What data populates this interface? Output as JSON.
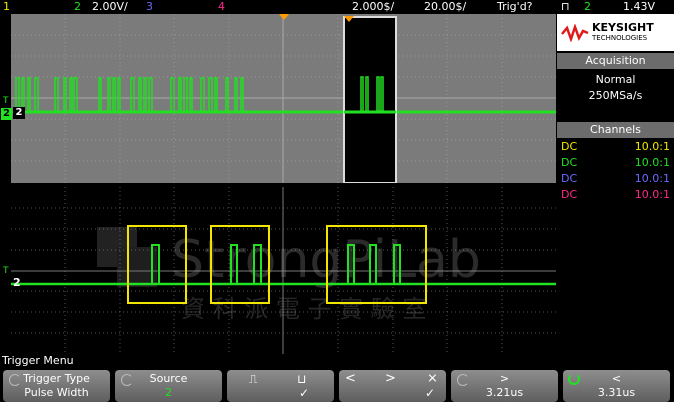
{
  "status": {
    "ch1": "1",
    "ch2": "2",
    "ch2_scale": "2.00V/",
    "ch3": "3",
    "ch4": "4",
    "timebase": "2.000$/",
    "zoom_time": "20.00$/",
    "trig_state": "Trig'd?",
    "trig_channel": "2",
    "trig_level": "1.43V"
  },
  "brand": {
    "name": "KEYSIGHT",
    "sub": "TECHNOLOGIES"
  },
  "acquisition": {
    "header": "Acquisition",
    "mode": "Normal",
    "rate": "250MSa/s"
  },
  "channels": {
    "header": "Channels",
    "rows": [
      {
        "coupling": "DC",
        "probe": "10.0:1",
        "color": "#f2e600"
      },
      {
        "coupling": "DC",
        "probe": "10.0:1",
        "color": "#22e022"
      },
      {
        "coupling": "DC",
        "probe": "10.0:1",
        "color": "#6a6aff"
      },
      {
        "coupling": "DC",
        "probe": "10.0:1",
        "color": "#ff2a8a"
      }
    ]
  },
  "watermark": {
    "text": "StrongPiLab",
    "sub": "資 科 派 電 子 實 驗 室"
  },
  "markers": {
    "ch2": "2",
    "trigger": "T"
  },
  "trigger_menu": {
    "title": "Trigger Menu"
  },
  "softkeys": {
    "trigger_type": {
      "label": "Trigger Type",
      "value": "Pulse Width"
    },
    "source": {
      "label": "Source",
      "value": "2"
    },
    "polarity": {
      "pos": "⎍",
      "neg": "⊔",
      "check": "✓"
    },
    "qualifier": {
      "lt": "<",
      "gt": ">",
      "range": "⨯",
      "check": "✓"
    },
    "gt_time": {
      "symbol": ">",
      "value": "3.21us"
    },
    "lt_time": {
      "symbol": "<",
      "value": "3.31us"
    }
  },
  "colors": {
    "ch1": "#f2e600",
    "ch2": "#22e022",
    "ch3": "#6a6aff",
    "ch4": "#ff2a8a",
    "trigger_marker": "#ff9a00",
    "highlight_box": "#f2e600"
  }
}
